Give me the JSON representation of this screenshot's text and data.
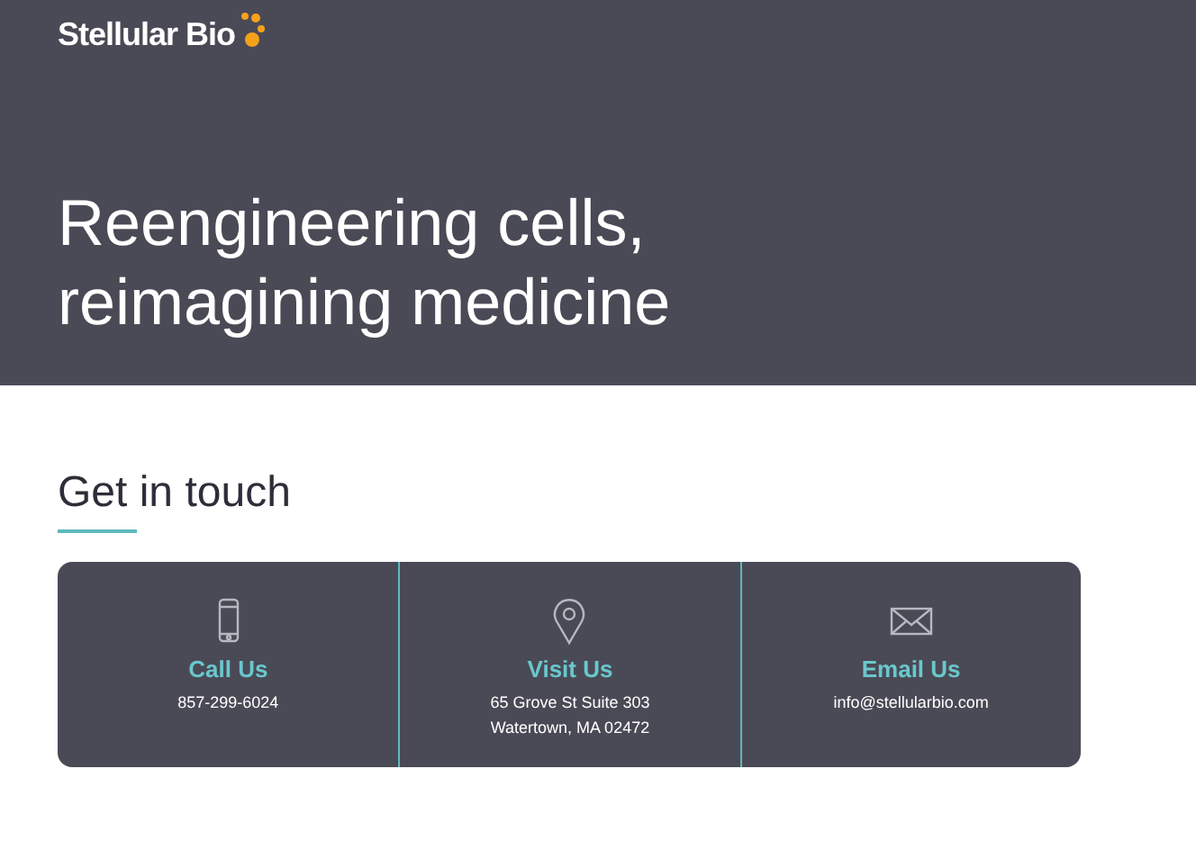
{
  "header": {
    "logo": "Stellular Bio",
    "headline": [
      "Reengineering cells,",
      "reimagining medicine"
    ]
  },
  "contact": {
    "title": "Get in touch",
    "items": [
      {
        "kind": "phone",
        "label": "Call Us",
        "lines": [
          "857-299-6024"
        ]
      },
      {
        "kind": "location",
        "label": "Visit Us",
        "lines": [
          "65 Grove St Suite 303",
          "Watertown, MA 02472"
        ]
      },
      {
        "kind": "email",
        "label": "Email Us",
        "lines": [
          "info@stellularbio.com"
        ]
      }
    ]
  }
}
